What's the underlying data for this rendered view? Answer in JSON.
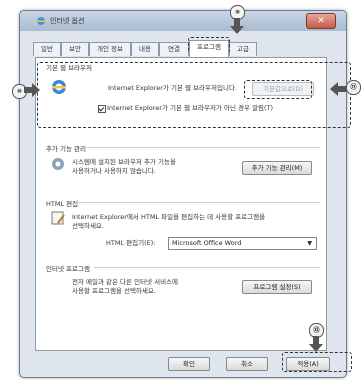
{
  "window": {
    "title": "인터넷 옵션",
    "close": "✕"
  },
  "tabs": [
    "일반",
    "보안",
    "개인 정보",
    "내용",
    "연결",
    "프로그램",
    "고급"
  ],
  "sections": {
    "default_browser": {
      "label": "기본 웹 브라우저",
      "text": "Internet Explorer가 기본 웹 브라우저입니다.",
      "button": "기본값으로(D)",
      "checkbox": "Internet Explorer가 기본 웹 브라우저가 아닌 경우 알림(T)"
    },
    "addons": {
      "label": "추가 기능 관리",
      "text_line1": "시스템에 설치된 브라우저 추가 기능을",
      "text_line2": "사용하거나 사용하지 않습니다.",
      "button": "추가 기능 관리(M)"
    },
    "html_editing": {
      "label": "HTML 편집",
      "text_line1": "Internet Explorer에서 HTML 파일을 편집하는 데 사용할 프로그램을",
      "text_line2": "선택하세요.",
      "editor_label": "HTML 편집기(E):",
      "editor_value": "Microsoft Office Word"
    },
    "internet_programs": {
      "label": "인터넷 프로그램",
      "text_line1": "전자 메일과 같은 다른 인터넷 서비스에",
      "text_line2": "사용할 프로그램을 선택하세요.",
      "button": "프로그램 설정(S)"
    }
  },
  "footer": {
    "ok": "확인",
    "cancel": "취소",
    "apply": "적용(A)"
  },
  "callouts": {
    "tab": "⑨",
    "section": "⑩",
    "button": "⑪",
    "apply": "⑫"
  }
}
